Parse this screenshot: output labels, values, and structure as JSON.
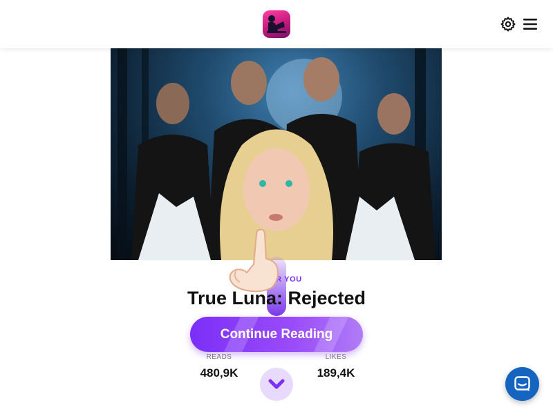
{
  "header": {
    "logo_icon": "app-logo-reading-girl",
    "settings_icon": "gear-icon",
    "menu_icon": "hamburger-menu-icon"
  },
  "cover": {
    "description_icon": "book-cover-artwork"
  },
  "story": {
    "kicker": "RY FOR YOU",
    "title": "True Luna: Rejected",
    "cta_label": "Continue Reading"
  },
  "stats": {
    "reads_label": "READS",
    "reads_value": "480,9K",
    "likes_label": "LIKES",
    "likes_value": "189,4K"
  },
  "colors": {
    "accent": "#7b2ff7",
    "chat_button": "#1565c0"
  },
  "icons": {
    "scroll": "chevron-down-icon",
    "swipe_hint": "pointing-hand-icon",
    "chat": "chat-bubble-icon"
  }
}
